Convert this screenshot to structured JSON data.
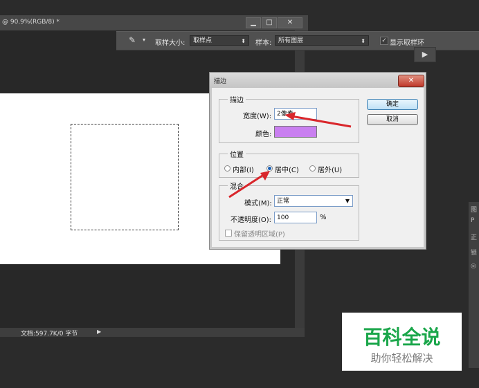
{
  "document": {
    "title": "@ 90.9%(RGB/8) *",
    "status": "文档:597.7K/0 字节"
  },
  "window_buttons": {
    "minimize": "▁",
    "restore": "□",
    "close": "✕"
  },
  "options_bar": {
    "sample_size_label": "取样大小:",
    "sample_size_value": "取样点",
    "sample_label": "样本:",
    "sample_value": "所有图层",
    "show_ring_label": "显示取样环",
    "show_ring_checked": true
  },
  "right_panel": {
    "items": [
      "图",
      "P",
      "正",
      "锁",
      "◎"
    ]
  },
  "dialog": {
    "title": "描边",
    "close": "✕",
    "stroke_group": {
      "title": "描边",
      "width_label": "宽度(W):",
      "width_value": "2像素",
      "color_label": "颜色:",
      "color": "#c97ff0"
    },
    "position_group": {
      "title": "位置",
      "options": [
        "内部(I)",
        "居中(C)",
        "居外(U)"
      ],
      "selected": "居中(C)"
    },
    "blend_group": {
      "title": "混合",
      "mode_label": "模式(M):",
      "mode_value": "正常",
      "opacity_label": "不透明度(O):",
      "opacity_value": "100",
      "opacity_unit": "%",
      "preserve_label": "保留透明区域(P)"
    },
    "ok_label": "确定",
    "cancel_label": "取消"
  },
  "annotation_color": "#d9262b",
  "watermark": {
    "title": "百科全说",
    "subtitle": "助你轻松解决"
  }
}
